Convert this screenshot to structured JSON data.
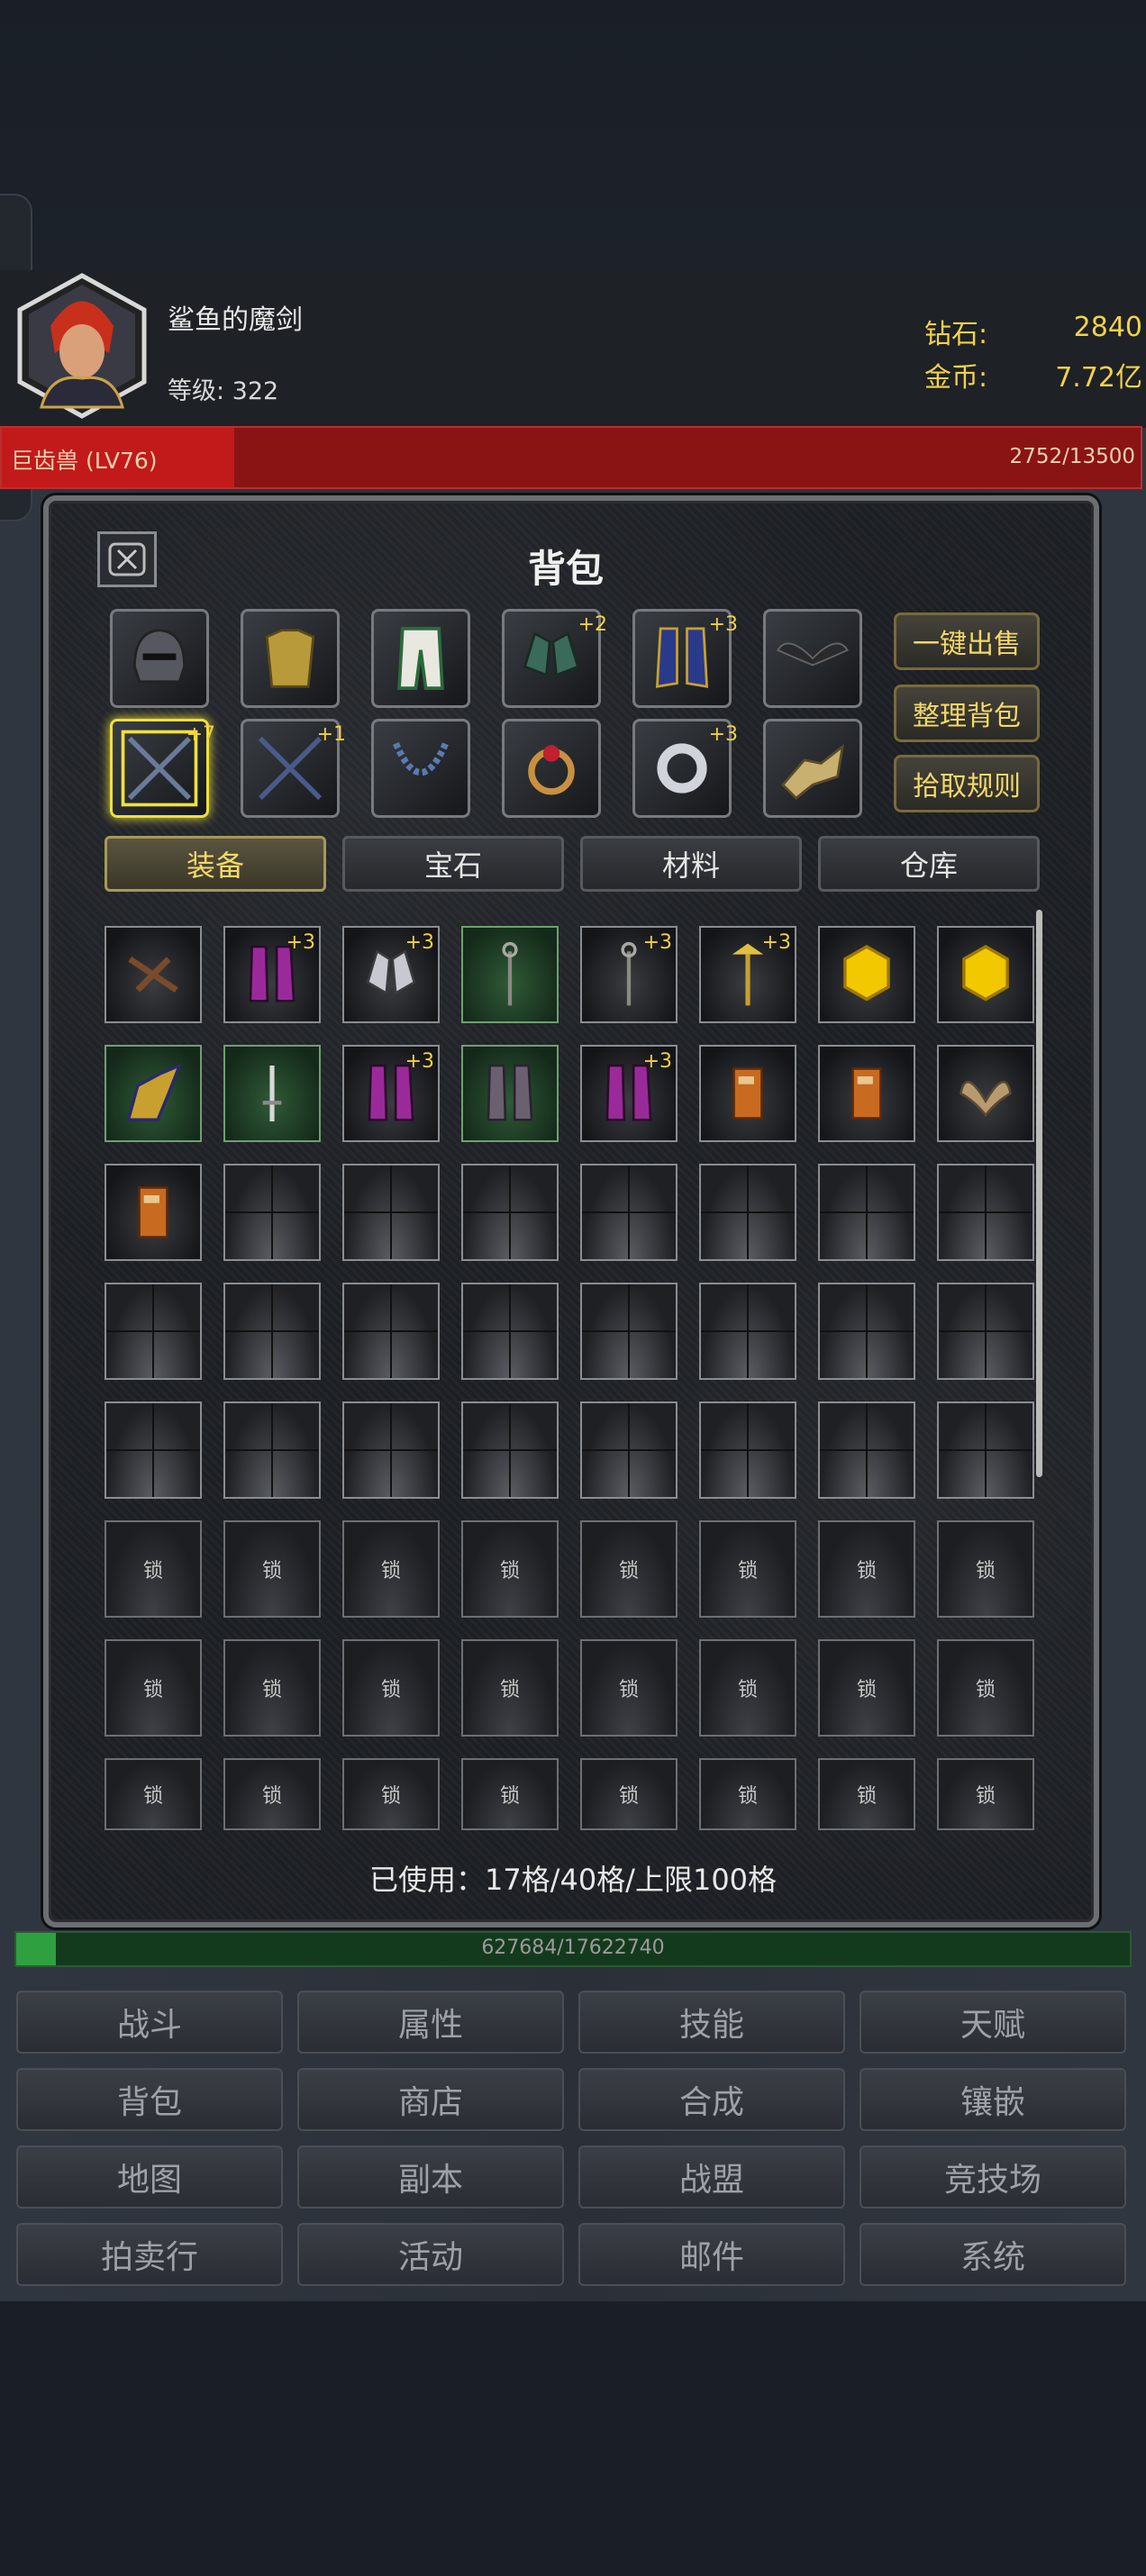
{
  "player": {
    "name": "鲨鱼的魔剑",
    "level": "等级: 322"
  },
  "currency": {
    "diamond_label": "钻石:",
    "diamond_value": "2840",
    "gold_label": "金币:",
    "gold_value": "7.72亿"
  },
  "boss": {
    "name": "巨齿兽 (LV76)",
    "hp": "2752/13500",
    "hp_fraction": 0.204
  },
  "panel": {
    "title": "背包"
  },
  "equipment": [
    {
      "icon": "helmet-icon",
      "plus": ""
    },
    {
      "icon": "armor-icon",
      "plus": ""
    },
    {
      "icon": "pants-icon",
      "plus": ""
    },
    {
      "icon": "gloves-icon",
      "plus": "+2"
    },
    {
      "icon": "boots-icon",
      "plus": "+3"
    },
    {
      "icon": "wings-icon",
      "plus": ""
    },
    {
      "icon": "weapon-icon",
      "plus": "+7"
    },
    {
      "icon": "offhand-weapon-icon",
      "plus": "+1"
    },
    {
      "icon": "necklace-icon",
      "plus": ""
    },
    {
      "icon": "ring-icon",
      "plus": ""
    },
    {
      "icon": "ring-silver-icon",
      "plus": "+3"
    },
    {
      "icon": "mount-icon",
      "plus": ""
    }
  ],
  "actions": [
    "一键出售",
    "整理背包",
    "拾取规则"
  ],
  "tabs": [
    "装备",
    "宝石",
    "材料",
    "仓库"
  ],
  "bag_items": [
    {
      "icon": "crossbow-icon",
      "plus": "",
      "green": false
    },
    {
      "icon": "purple-boots-icon",
      "plus": "+3",
      "green": false
    },
    {
      "icon": "silver-gloves-icon",
      "plus": "+3",
      "green": false
    },
    {
      "icon": "staff-icon",
      "plus": "",
      "green": true
    },
    {
      "icon": "staff-icon",
      "plus": "+3",
      "green": false
    },
    {
      "icon": "gold-staff-icon",
      "plus": "+3",
      "green": false
    },
    {
      "icon": "gold-gem-icon",
      "plus": "",
      "green": false
    },
    {
      "icon": "gold-gem-icon",
      "plus": "",
      "green": false
    },
    {
      "icon": "gold-armor-icon",
      "plus": "",
      "green": true
    },
    {
      "icon": "dagger-icon",
      "plus": "",
      "green": true
    },
    {
      "icon": "purple-boots-icon",
      "plus": "+3",
      "green": false
    },
    {
      "icon": "dark-boots-icon",
      "plus": "",
      "green": true
    },
    {
      "icon": "purple-boots-icon",
      "plus": "+3",
      "green": false
    },
    {
      "icon": "book-icon",
      "plus": "",
      "green": false
    },
    {
      "icon": "book-icon",
      "plus": "",
      "green": false
    },
    {
      "icon": "wings-item-icon",
      "plus": "",
      "green": false
    },
    {
      "icon": "book-icon",
      "plus": "",
      "green": false
    }
  ],
  "lock_label": "锁",
  "usage": "已使用：17格/40格/上限100格",
  "exp": {
    "text": "627684/17622740",
    "fraction": 0.036
  },
  "nav": [
    "战斗",
    "属性",
    "技能",
    "天赋",
    "背包",
    "商店",
    "合成",
    "镶嵌",
    "地图",
    "副本",
    "战盟",
    "竞技场",
    "拍卖行",
    "活动",
    "邮件",
    "系统"
  ]
}
